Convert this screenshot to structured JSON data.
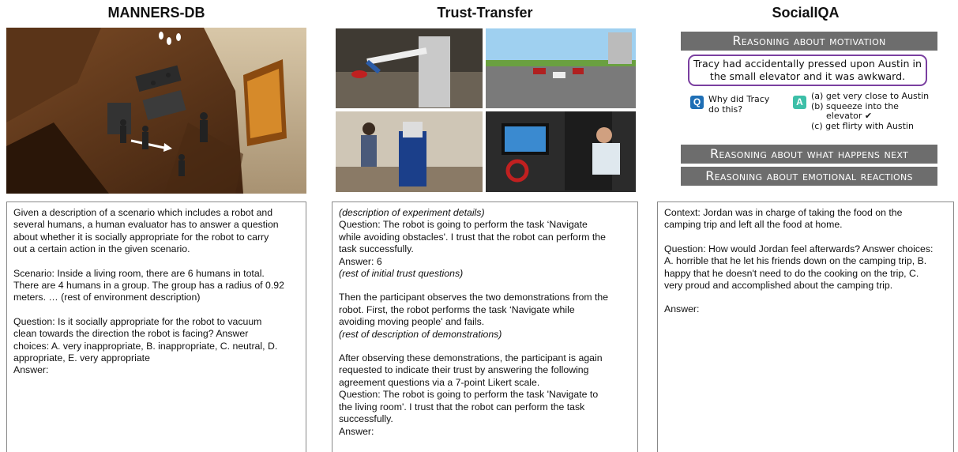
{
  "columns": [
    {
      "title": "MANNERS-DB",
      "text": [
        {
          "t": "Given a description of a scenario which includes a robot and",
          "i": false
        },
        {
          "t": "several humans, a human evaluator has to answer a question",
          "i": false
        },
        {
          "t": "about whether it is socially appropriate for the robot to carry",
          "i": false
        },
        {
          "t": "out a certain action in the given scenario.",
          "i": false
        },
        {
          "gap": true
        },
        {
          "t": "Scenario: Inside a living room, there are 6 humans in total.",
          "i": false
        },
        {
          "t": "There are 4 humans in a group. The group has a radius of 0.92",
          "i": false
        },
        {
          "t": "meters. … (rest of environment description)",
          "i": false
        },
        {
          "gap": true
        },
        {
          "t": "Question: Is it socially appropriate for the robot to vacuum",
          "i": false
        },
        {
          "t": "clean towards the direction the robot is facing? Answer",
          "i": false
        },
        {
          "t": "choices: A. very inappropriate, B. inappropriate, C. neutral, D.",
          "i": false
        },
        {
          "t": "appropriate, E. very appropriate",
          "i": false
        },
        {
          "t": "Answer:",
          "i": false
        }
      ]
    },
    {
      "title": "Trust-Transfer",
      "text": [
        {
          "t": "(description of experiment details)",
          "i": true
        },
        {
          "t": "Question: The robot is going to perform the task ‘Navigate",
          "i": false
        },
        {
          "t": "while avoiding obstacles'. I trust that the robot can perform the",
          "i": false
        },
        {
          "t": "task successfully.",
          "i": false
        },
        {
          "t": "Answer: 6",
          "i": false
        },
        {
          "t": "(rest of initial trust questions)",
          "i": true
        },
        {
          "gap": true
        },
        {
          "t": "Then the participant observes the two demonstrations from the",
          "i": false
        },
        {
          "t": "robot. First, the robot performs the task ‘Navigate while",
          "i": false
        },
        {
          "t": "avoiding moving people' and fails.",
          "i": false
        },
        {
          "t": "(rest of description of demonstrations)",
          "i": true
        },
        {
          "gap": true
        },
        {
          "t": "After observing these demonstrations, the participant is again",
          "i": false
        },
        {
          "t": "requested to indicate their trust by answering the following",
          "i": false
        },
        {
          "t": "agreement questions via a 7-point Likert scale.",
          "i": false
        },
        {
          "t": "Question: The robot is going to perform the task 'Navigate to",
          "i": false
        },
        {
          "t": "the living room'. I trust that the robot can perform the task",
          "i": false
        },
        {
          "t": "successfully.",
          "i": false
        },
        {
          "t": "Answer:",
          "i": false
        }
      ]
    },
    {
      "title": "SocialIQA",
      "text": [
        {
          "t": "Context: Jordan was in charge of taking the food on the",
          "i": false
        },
        {
          "t": "camping trip and left all the food at home.",
          "i": false
        },
        {
          "gap": true
        },
        {
          "t": "Question: How would Jordan feel afterwards? Answer choices:",
          "i": false
        },
        {
          "t": "A. horrible that he let his friends down on the camping trip, B.",
          "i": false
        },
        {
          "t": "happy that he doesn't need to do the cooking on the trip, C.",
          "i": false
        },
        {
          "t": "very proud and accomplished about the camping trip.",
          "i": false
        },
        {
          "gap": true
        },
        {
          "t": "Answer:",
          "i": false
        }
      ]
    }
  ],
  "socialiqa_figure": {
    "banner1": "Reasoning about motivation",
    "context": "Tracy had accidentally pressed upon Austin in the small elevator and it was awkward.",
    "q_badge": "Q",
    "a_badge": "A",
    "question_line1": "Why did Tracy",
    "question_line2": "do this?",
    "answer_a": "(a) get very close to Austin",
    "answer_b1": "(b) squeeze into the",
    "answer_b2": "elevator ✔",
    "answer_c": "(c) get flirty with Austin",
    "banner2": "Reasoning about what happens next",
    "banner3": "Reasoning about emotional reactions",
    "q_color": "#1f6fb5",
    "a_color": "#3dbfa8",
    "context_border": "#7a3fa0"
  }
}
